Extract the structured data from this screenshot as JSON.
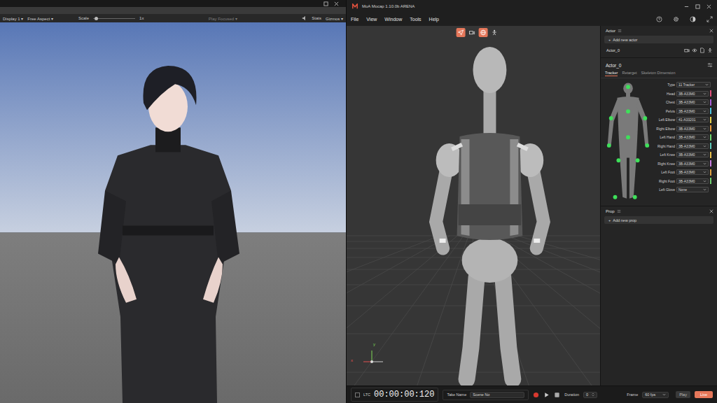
{
  "game_window": {
    "toolbar": {
      "display": "Display 1",
      "aspect": "Free Aspect",
      "scale_label": "Scale",
      "scale_value": "1x",
      "scale_level": 0.04,
      "play_mode": "Play Focused",
      "stats": "Stats",
      "gizmos": "Gizmos"
    }
  },
  "app": {
    "title": "MoA Mocap 1.10.0b ARENA",
    "menu": [
      "File",
      "View",
      "Window",
      "Tools",
      "Help"
    ]
  },
  "viewport": {
    "tools": [
      {
        "selected": true
      },
      {
        "selected": false
      },
      {
        "selected": true
      },
      {
        "selected": false
      }
    ],
    "axis": [
      "x",
      "y"
    ]
  },
  "actor_panel": {
    "title": "Actor",
    "add_icon": "+",
    "add_button": "Add new actor",
    "actors": [
      {
        "name": "Actor_0",
        "selected": false
      }
    ],
    "actor_title": "Actor_0",
    "tabs": [
      {
        "label": "Tracker",
        "selected": true
      },
      {
        "label": "Retarget",
        "selected": false
      },
      {
        "label": "Skeleton Dimension",
        "selected": false
      }
    ],
    "type_label": "Type",
    "type_value": "11 Tracker",
    "trackers": [
      {
        "name": "Head",
        "device": "3B-A33M0",
        "color": "#e0507a"
      },
      {
        "name": "Chest",
        "device": "3B-A33M0",
        "color": "#a85cd6"
      },
      {
        "name": "Pelvis",
        "device": "3B-A33M0",
        "color": "#4cc3e0"
      },
      {
        "name": "Left Elbow",
        "device": "41-A33201",
        "color": "#e8d44c"
      },
      {
        "name": "Right Elbow",
        "device": "3B-A33M0",
        "color": "#e89a3c"
      },
      {
        "name": "Left Hand",
        "device": "3B-A33M0",
        "color": "#6cd66c"
      },
      {
        "name": "Right Hand",
        "device": "3B-A33M0",
        "color": "#5cc8b8"
      },
      {
        "name": "Left Knee",
        "device": "3B-A33M0",
        "color": "#e8c04c"
      },
      {
        "name": "Right Knee",
        "device": "3B-A33M0",
        "color": "#c87ce0"
      },
      {
        "name": "Left Foot",
        "device": "3B-A33M0",
        "color": "#e0a040"
      },
      {
        "name": "Right Foot",
        "device": "3B-A33M0",
        "color": "#70d070"
      },
      {
        "name": "Left Glove",
        "device": "None"
      }
    ]
  },
  "prop_panel": {
    "title": "Prop",
    "add_icon": "+",
    "add_button": "Add new prop"
  },
  "timeline": {
    "ltc": "LTC",
    "ltc_checked": false,
    "timecode": "00:00:00:120",
    "take_label": "Take Name",
    "take_value": "Scene No",
    "duration_label": "Duration",
    "duration_value": "0",
    "frame_label": "Frame",
    "frame_value": "60 fps",
    "play": "Play",
    "live": "Live",
    "live_selected": true
  }
}
